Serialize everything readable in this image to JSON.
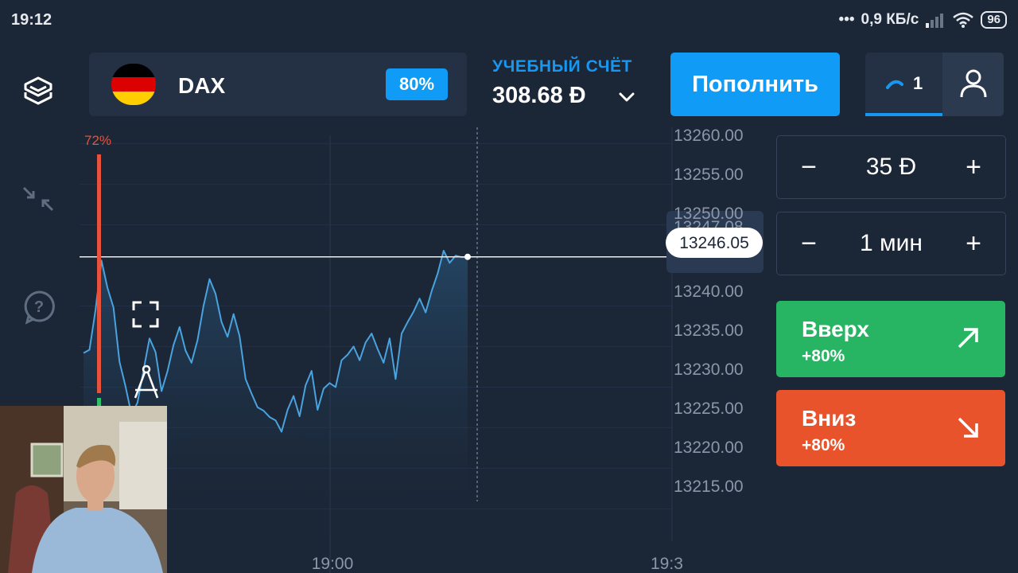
{
  "status_bar": {
    "time": "19:12",
    "network_speed": "0,9 КБ/с",
    "battery": "96",
    "icons": [
      "dots-icon",
      "signal-icon",
      "wifi-icon",
      "battery-icon"
    ]
  },
  "header": {
    "menu_icon": "layers-icon",
    "asset": {
      "name": "DAX",
      "payout_badge": "80%",
      "flag_colors": [
        "#000000",
        "#dd0000",
        "#ffce00"
      ]
    },
    "account": {
      "label": "УЧЕБНЫЙ СЧЁТ",
      "balance": "308.68 Đ",
      "toggle_icon": "chevron-down-icon"
    },
    "deposit_label": "Пополнить",
    "trades": {
      "count": "1",
      "icon": "trades-icon"
    },
    "profile_icon": "user-icon"
  },
  "chart": {
    "sentiment_up": "72%",
    "price_axis": [
      "13260.00",
      "13255.00",
      "13250.00",
      "13247.08",
      "13240.00",
      "13235.00",
      "13230.00",
      "13225.00",
      "13220.00",
      "13215.00"
    ],
    "time_axis": [
      "19:00",
      "19:3"
    ],
    "current_price": "13246.05",
    "colors": {
      "line": "#4aa3df",
      "sentiment_up": "#e8523a",
      "sentiment_down": "#2ec06a",
      "background": "#1b2636"
    },
    "tool_icons": [
      "collapse-icon",
      "help-icon",
      "fullscreen-icon",
      "compass-icon"
    ]
  },
  "chart_data": {
    "type": "line",
    "x": [
      0,
      1,
      2,
      3,
      4,
      5,
      6,
      7,
      8,
      9,
      10,
      11,
      12,
      13,
      14,
      15,
      16,
      17,
      18,
      19,
      20,
      21,
      22,
      23,
      24,
      25,
      26,
      27,
      28,
      29,
      30,
      31,
      32,
      33,
      34,
      35,
      36,
      37,
      38,
      39,
      40,
      41,
      42,
      43,
      44,
      45,
      46,
      47,
      48,
      49,
      50,
      51,
      52,
      53,
      54,
      55,
      56,
      57,
      58,
      59,
      60,
      61,
      62,
      63,
      64,
      65,
      66,
      67,
      68,
      69,
      70,
      71,
      72,
      73,
      74,
      75,
      76,
      77,
      78,
      79
    ],
    "series": [
      {
        "values": [
          13234.2,
          13234.6,
          13239.5,
          13245.6,
          13242.2,
          13239.8,
          13233.1,
          13230.1,
          13226.6,
          13228.1,
          13232.1,
          13236.0,
          13234.3,
          13229.5,
          13232.0,
          13235.2,
          13237.4,
          13234.5,
          13233.0,
          13235.8,
          13240.0,
          13243.3,
          13241.5,
          13238.0,
          13236.2,
          13239.0,
          13236.3,
          13231.0,
          13229.2,
          13227.5,
          13227.1,
          13226.3,
          13225.9,
          13224.5,
          13227.2,
          13228.9,
          13226.4,
          13230.2,
          13232.0,
          13227.2,
          13229.8,
          13230.5,
          13230.0,
          13233.3,
          13234.0,
          13235.0,
          13233.3,
          13235.5,
          13236.6,
          13234.7,
          13233.0,
          13236.0,
          13231.0,
          13236.6,
          13238.0,
          13239.3,
          13240.9,
          13239.2,
          13241.8,
          13244.0,
          13246.8,
          13245.3,
          13246.2,
          13246.0,
          13246.05
        ]
      }
    ],
    "ylim": [
      13212,
      13262
    ],
    "yticks": [
      13260,
      13255,
      13250,
      13240,
      13235,
      13230,
      13225,
      13220,
      13215
    ],
    "xticks": [
      "19:00",
      "19:3"
    ],
    "grid": true
  },
  "controls": {
    "amount": {
      "minus": "−",
      "value": "35 Đ",
      "plus": "+"
    },
    "duration": {
      "minus": "−",
      "value": "1 мин",
      "plus": "+"
    },
    "up": {
      "label": "Вверх",
      "payout": "+80%",
      "color": "#27b563",
      "icon": "arrow-up-right-icon"
    },
    "down": {
      "label": "Вниз",
      "payout": "+80%",
      "color": "#e8532c",
      "icon": "arrow-down-right-icon"
    }
  },
  "overlay": {
    "webcam_icon": "webcam-overlay"
  }
}
